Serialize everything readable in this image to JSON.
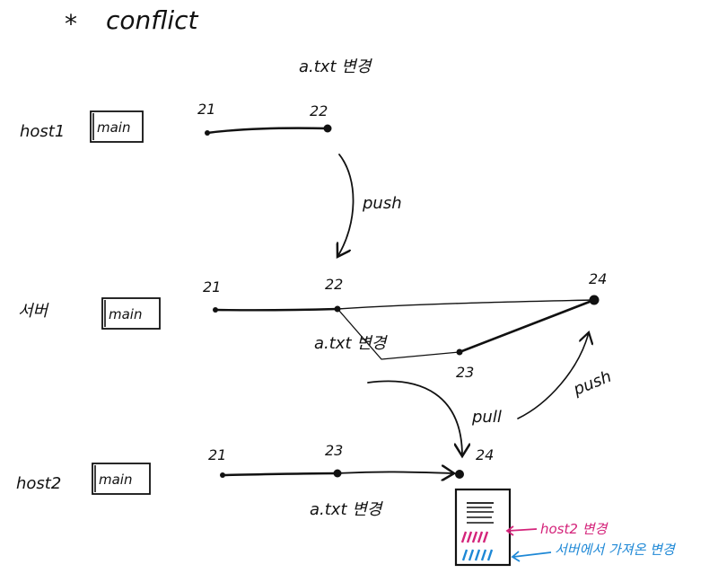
{
  "title": {
    "star": "*",
    "text": "conflict"
  },
  "top_annotation": "a.txt 변경",
  "rows": [
    {
      "host": "host1",
      "branch": "main",
      "commits": [
        "21",
        "22"
      ]
    },
    {
      "host": "서버",
      "branch": "main",
      "commits": [
        "21",
        "22",
        "24"
      ],
      "side_commit": "23",
      "side_label": "a.txt 변경"
    },
    {
      "host": "host2",
      "branch": "main",
      "commits": [
        "21",
        "23",
        "24"
      ],
      "commit_label": "a.txt 변경"
    }
  ],
  "arrows": {
    "push_down": "push",
    "pull": "pull",
    "push_up": "push"
  },
  "legend": {
    "pink_label": "host2 변경",
    "blue_label": "서버에서 가져온 변경",
    "pink_color": "#d4237a",
    "blue_color": "#1e88d6"
  }
}
